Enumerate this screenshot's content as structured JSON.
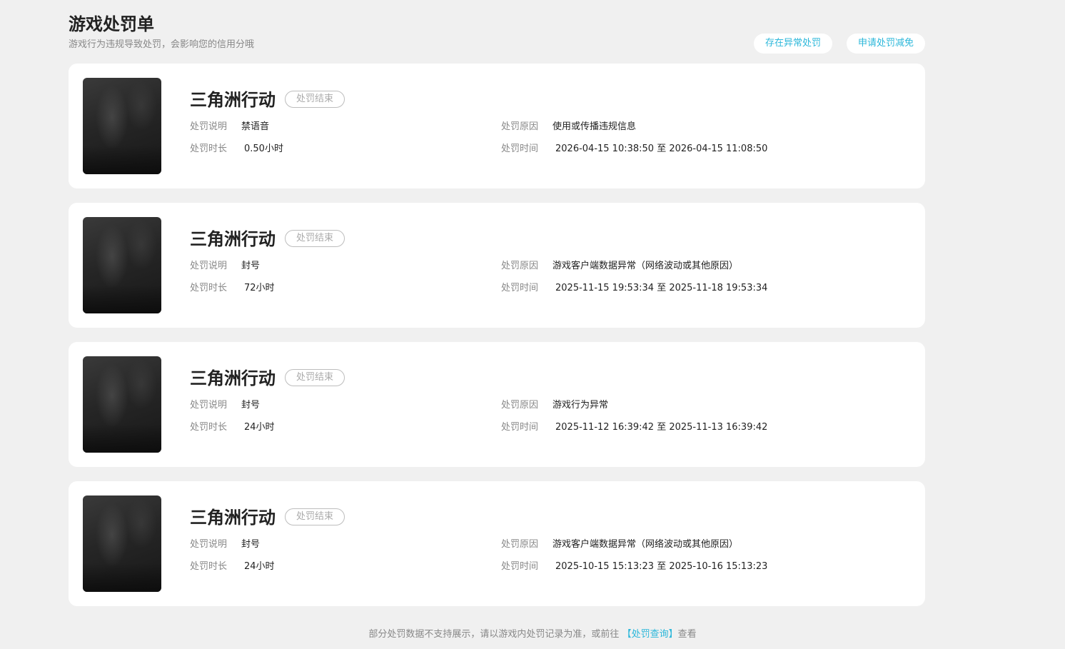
{
  "header": {
    "title": "游戏处罚单",
    "subtitle": "游戏行为违规导致处罚，会影响您的信用分哦",
    "abnormal_button": "存在异常处罚",
    "appeal_button": "申请处罚减免"
  },
  "labels": {
    "description": "处罚说明",
    "duration": "处罚时长",
    "reason": "处罚原因",
    "time": "处罚时间"
  },
  "records": [
    {
      "game": "三角洲行动",
      "status": "处罚结束",
      "description": "禁语音",
      "duration": "0.50小时",
      "reason": "使用或传播违规信息",
      "time": "2026-04-15 10:38:50 至 2026-04-15 11:08:50"
    },
    {
      "game": "三角洲行动",
      "status": "处罚结束",
      "description": "封号",
      "duration": "72小时",
      "reason": "游戏客户端数据异常（网络波动或其他原因）",
      "time": "2025-11-15 19:53:34 至 2025-11-18 19:53:34"
    },
    {
      "game": "三角洲行动",
      "status": "处罚结束",
      "description": "封号",
      "duration": "24小时",
      "reason": "游戏行为异常",
      "time": "2025-11-12 16:39:42 至 2025-11-13 16:39:42"
    },
    {
      "game": "三角洲行动",
      "status": "处罚结束",
      "description": "封号",
      "duration": "24小时",
      "reason": "游戏客户端数据异常（网络波动或其他原因）",
      "time": "2025-10-15 15:13:23 至 2025-10-16 15:13:23"
    }
  ],
  "footer": {
    "note_prefix": "部分处罚数据不支持展示，请以游戏内处罚记录为准，或前往",
    "link": "【处罚查询】",
    "note_suffix": "查看"
  },
  "colors": {
    "accent": "#2bb7da",
    "background": "#f0f0f0",
    "card": "#ffffff"
  }
}
